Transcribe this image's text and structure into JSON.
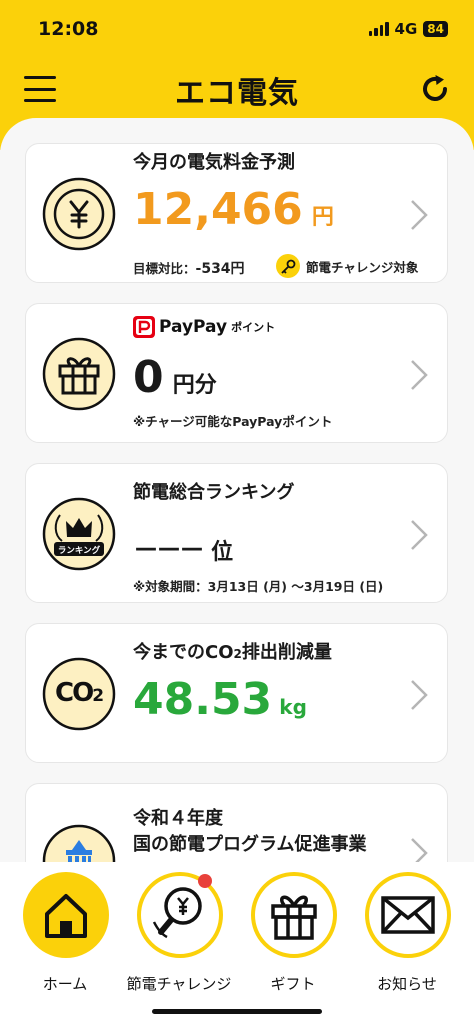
{
  "status": {
    "time": "12:08",
    "network": "4G",
    "battery": "84"
  },
  "header": {
    "title": "エコ電気"
  },
  "cards": {
    "forecast": {
      "title": "今月の電気料金予測",
      "amount": "12,466",
      "unit": "円",
      "target_label": "目標対比：",
      "target_value": "-534円",
      "badge": "節電チャレンジ対象"
    },
    "paypay": {
      "logo_text": "PayPay",
      "logo_sub": "ポイント",
      "amount": "0",
      "unit": "円分",
      "note": "※チャージ可能なPayPayポイント"
    },
    "ranking": {
      "title": "節電総合ランキング",
      "rank": "－－－",
      "unit": "位",
      "icon_text": "ランキング",
      "note": "※対象期間：3月13日 (月) ～3月19日 (日)"
    },
    "co2": {
      "title_pre": "今までのCO",
      "title_sub": "2",
      "title_post": "排出削減量",
      "amount": "48.53",
      "unit": "kg",
      "icon_main": "CO",
      "icon_sub": "2"
    },
    "program": {
      "title_line1": "令和４年度",
      "title_line2": "国の節電プログラム促進事業"
    }
  },
  "bottom_nav": {
    "items": [
      {
        "label": "ホーム"
      },
      {
        "label": "節電チャレンジ"
      },
      {
        "label": "ギフト"
      },
      {
        "label": "お知らせ"
      }
    ]
  },
  "colors": {
    "brand": "#fbd10a",
    "orange": "#f29a1e",
    "green": "#29a83b",
    "paypay_red": "#e60012"
  }
}
